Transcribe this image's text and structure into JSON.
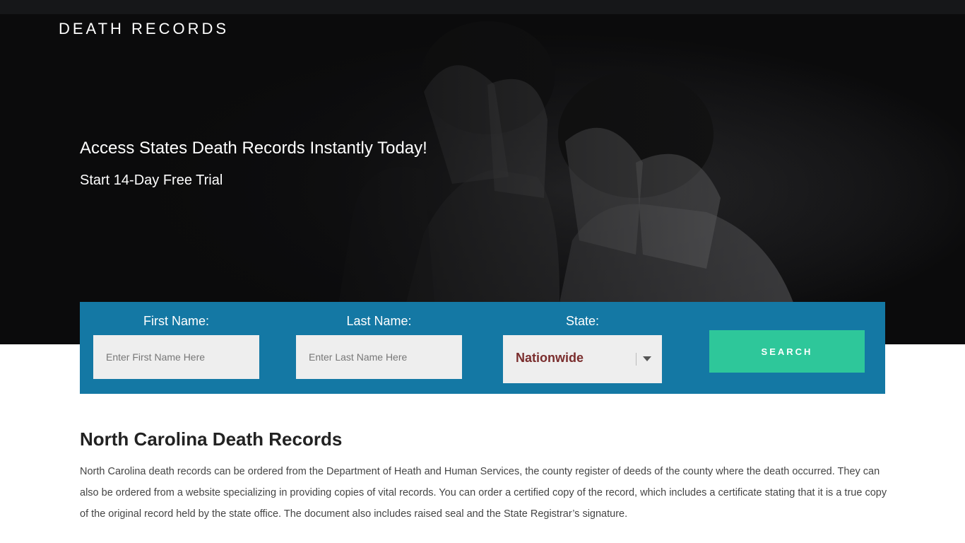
{
  "site": {
    "brand": "DEATH RECORDS"
  },
  "hero": {
    "headline": "Access States Death Records Instantly Today!",
    "subline": "Start 14-Day Free Trial"
  },
  "search": {
    "first_name_label": "First Name:",
    "first_name_placeholder": "Enter First Name Here",
    "last_name_label": "Last Name:",
    "last_name_placeholder": "Enter Last Name Here",
    "state_label": "State:",
    "state_value": "Nationwide",
    "button_label": "SEARCH"
  },
  "content": {
    "title": "North Carolina Death Records",
    "body": "North Carolina death records can be ordered from the Department of Heath and Human Services, the county register of deeds of the county where the death occurred. They can also be ordered from a website specializing in providing copies of vital records. You can order a certified copy of the record, which includes a certificate stating that it is a true copy of the original record held by the state office. The document also includes raised seal and the State Registrar’s signature."
  },
  "colors": {
    "hero_background": "#0b0b0c",
    "search_panel": "#1478a4",
    "search_button": "#2ec79a",
    "select_value": "#7a2d2d"
  },
  "icons": {
    "select_caret": "chevron-down-icon"
  }
}
